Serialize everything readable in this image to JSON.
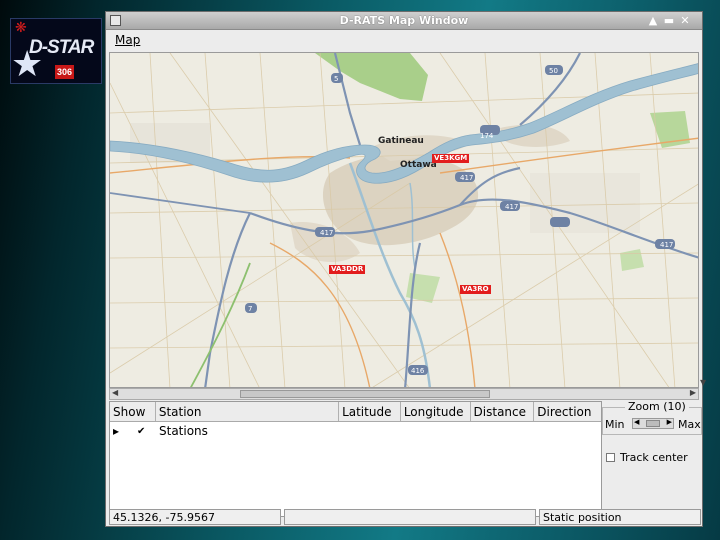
{
  "logo": {
    "text": "D-STAR",
    "badge": "306"
  },
  "window": {
    "title": "D-RATS Map Window"
  },
  "menu": {
    "items": [
      "Map"
    ]
  },
  "map": {
    "city_labels": [
      "Ottawa",
      "Gatineau"
    ],
    "markers": [
      "VE3KGM",
      "VA3DDR",
      "VA3RO"
    ],
    "highways": [
      "417",
      "417",
      "417",
      "417",
      "174",
      "416",
      "7",
      "5",
      "50"
    ]
  },
  "table": {
    "columns": [
      "Show",
      "Station",
      "Latitude",
      "Longitude",
      "Distance",
      "Direction"
    ],
    "rows": [
      {
        "expander": "▸",
        "show": "✔",
        "station": "Stations"
      }
    ]
  },
  "zoom": {
    "label": "Zoom (10)",
    "min_label": "Min",
    "max_label": "Max",
    "level": 10
  },
  "track": {
    "label": "Track center",
    "checked": false
  },
  "status": {
    "coords": "45.1326, -75.9567",
    "middle": "",
    "mode": "Static position"
  }
}
